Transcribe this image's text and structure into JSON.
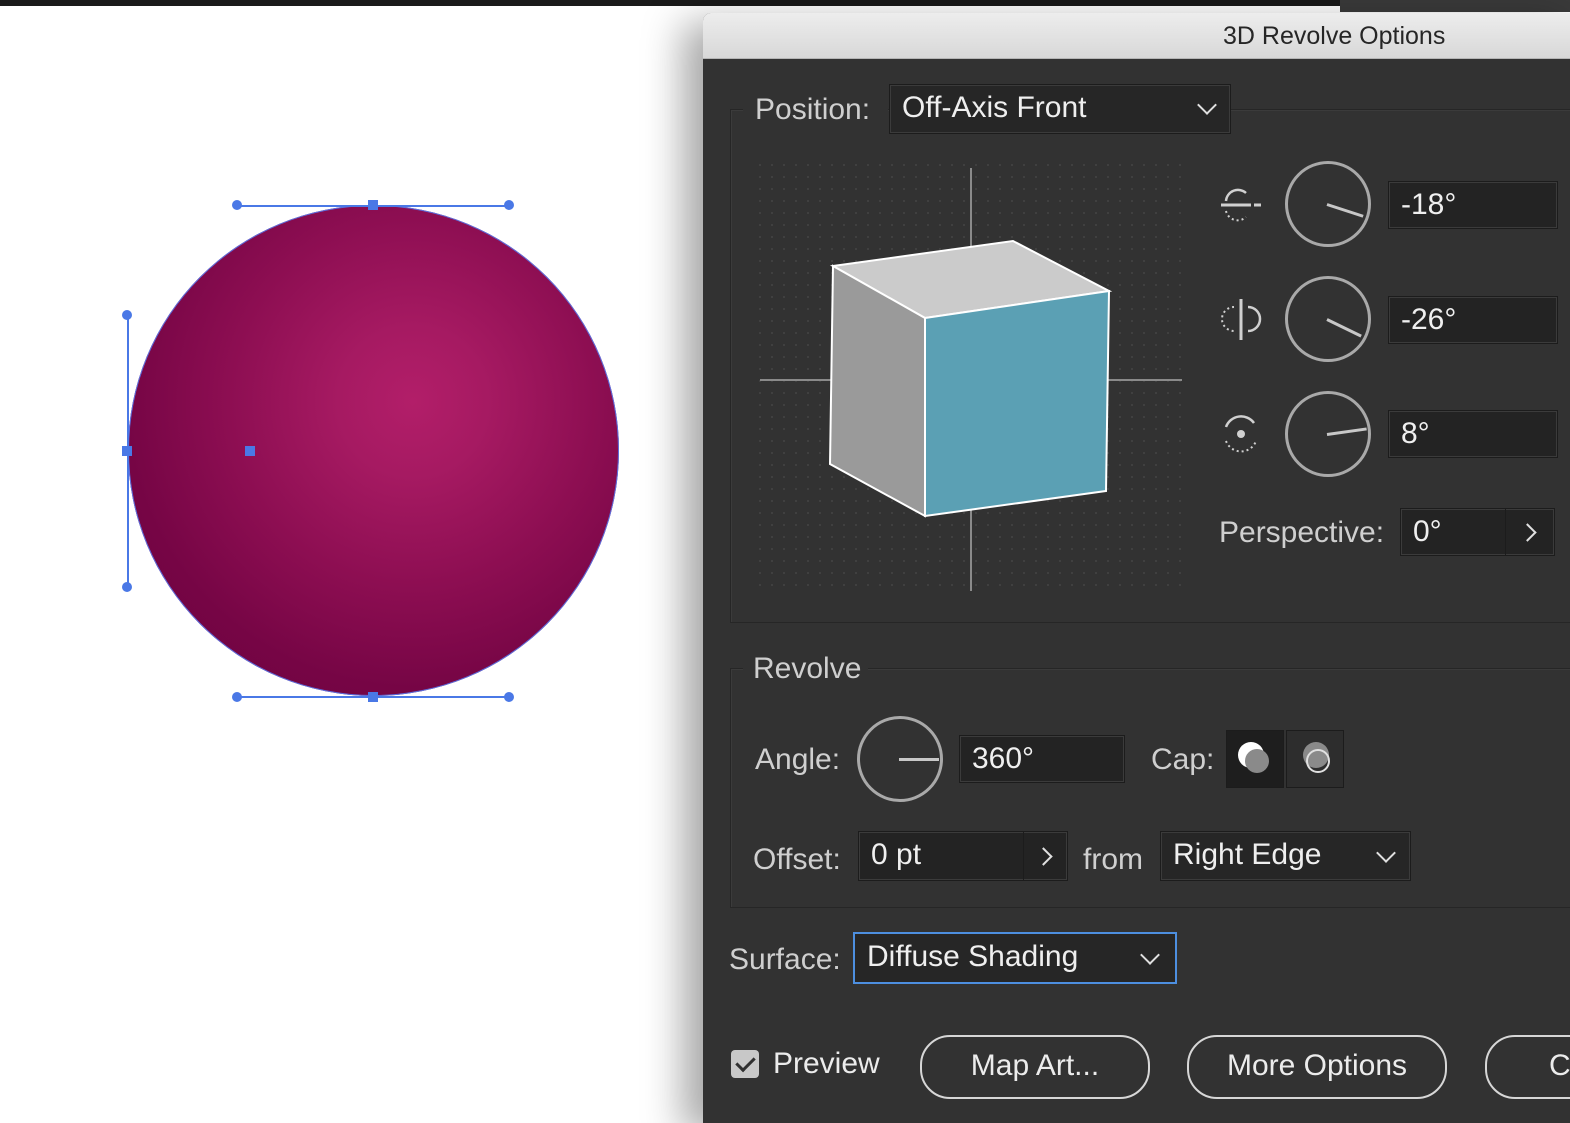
{
  "dialog": {
    "title": "3D Revolve Options"
  },
  "position": {
    "label": "Position:",
    "value": "Off-Axis Front",
    "x_rotation": "-18°",
    "y_rotation": "-26°",
    "z_rotation": "8°",
    "perspective_label": "Perspective:",
    "perspective_value": "0°"
  },
  "revolve": {
    "heading": "Revolve",
    "angle_label": "Angle:",
    "angle_value": "360°",
    "cap_label": "Cap:",
    "offset_label": "Offset:",
    "offset_value": "0 pt",
    "from_label": "from",
    "from_value": "Right Edge"
  },
  "surface": {
    "label": "Surface:",
    "value": "Diffuse Shading"
  },
  "footer": {
    "preview_label": "Preview",
    "preview_checked": true,
    "map_art_label": "Map Art...",
    "more_options_label": "More Options",
    "cancel_label_partial": "C"
  },
  "colors": {
    "sphere": "#a01a5e",
    "cube_front": "#5ba0b4",
    "selection": "#4a78e6",
    "dialog_bg": "#323232"
  },
  "icons": {
    "x_axis": "rotate-x-icon",
    "y_axis": "rotate-y-icon",
    "z_axis": "rotate-z-icon",
    "cap_on": "cap-on-icon",
    "cap_off": "cap-off-icon"
  }
}
